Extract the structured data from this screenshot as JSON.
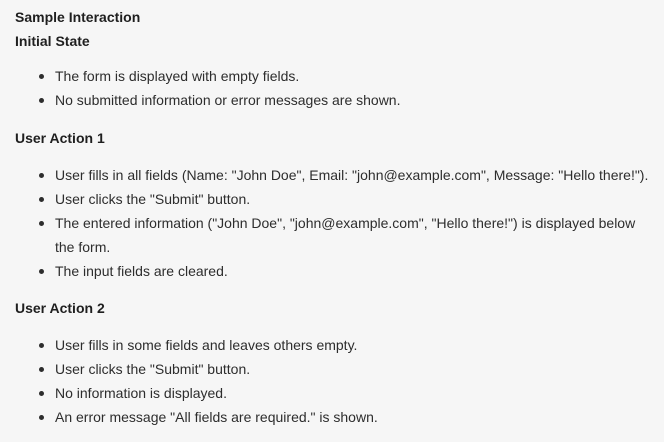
{
  "title": "Sample Interaction",
  "sections": [
    {
      "heading": "Initial State",
      "items": [
        "The form is displayed with empty fields.",
        "No submitted information or error messages are shown."
      ]
    },
    {
      "heading": "User Action 1",
      "items": [
        "User fills in all fields (Name: \"John Doe\", Email: \"john@example.com\", Message: \"Hello there!\").",
        "User clicks the \"Submit\" button.",
        "The entered information (\"John Doe\", \"john@example.com\", \"Hello there!\") is displayed below the form.",
        "The input fields are cleared."
      ]
    },
    {
      "heading": "User Action 2",
      "items": [
        "User fills in some fields and leaves others empty.",
        "User clicks the \"Submit\" button.",
        "No information is displayed.",
        "An error message \"All fields are required.\" is shown."
      ]
    }
  ]
}
